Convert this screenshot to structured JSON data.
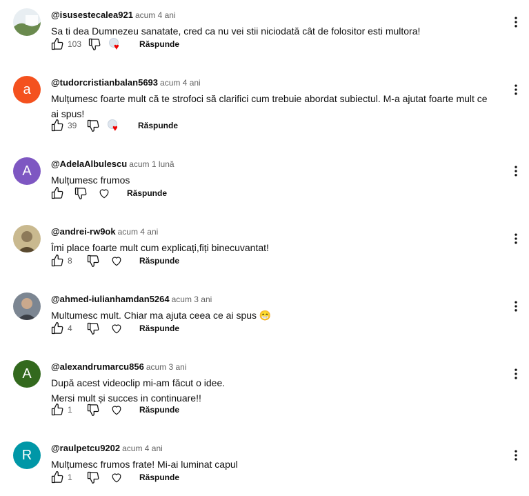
{
  "reply_label": "Răspunde",
  "icons": {
    "like": "thumb-up-icon",
    "dislike": "thumb-down-icon",
    "heart": "heart-outline-icon",
    "creator_heart": "creator-heart-icon",
    "menu": "more-vertical-icon"
  },
  "colors": {
    "heart_red": "#e00000",
    "meta_gray": "#606060"
  },
  "comments": [
    {
      "author": "@isusestecalea921",
      "time": "acum 4 ani",
      "lines": [
        "Sa ti dea Dumnezeu sanatate, cred ca nu vei stii niciodată cât de folositor esti multora!"
      ],
      "likes": "103",
      "creator_heart": true,
      "avatar_letter": "",
      "avatar_color": "#6a8a4e"
    },
    {
      "author": "@tudorcristianbalan5693",
      "time": "acum 4 ani",
      "lines": [
        "Mulțumesc foarte mult că te strofoci să clarifici cum trebuie abordat subiectul. M-a ajutat foarte mult ce",
        "ai spus!"
      ],
      "likes": "39",
      "creator_heart": true,
      "avatar_letter": "a",
      "avatar_color": "#f4511e"
    },
    {
      "author": "@AdelaAlbulescu",
      "time": "acum 1 lună",
      "lines": [
        "Mulțumesc frumos"
      ],
      "likes": "",
      "creator_heart": false,
      "avatar_letter": "A",
      "avatar_color": "#7e57c2"
    },
    {
      "author": "@andrei-rw9ok",
      "time": "acum 4 ani",
      "lines": [
        "Îmi place foarte mult cum explicați,fiți binecuvantat!"
      ],
      "likes": "8",
      "creator_heart": false,
      "avatar_letter": "",
      "avatar_color": "#8d7a5a"
    },
    {
      "author": "@ahmed-iulianhamdan5264",
      "time": "acum 3 ani",
      "lines": [
        "Multumesc mult. Chiar ma ajuta ceea ce ai spus 😁"
      ],
      "likes": "4",
      "creator_heart": false,
      "avatar_letter": "",
      "avatar_color": "#3b3f46"
    },
    {
      "author": "@alexandrumarcu856",
      "time": "acum 3 ani",
      "lines": [
        "După acest videoclip mi-am făcut o idee.",
        "Mersi mult și succes in continuare!!"
      ],
      "likes": "1",
      "creator_heart": false,
      "avatar_letter": "A",
      "avatar_color": "#33691e"
    },
    {
      "author": "@raulpetcu9202",
      "time": "acum 4 ani",
      "lines": [
        "Mulțumesc frumos frate! Mi-ai luminat capul"
      ],
      "likes": "1",
      "creator_heart": false,
      "avatar_letter": "R",
      "avatar_color": "#0097a7"
    }
  ]
}
